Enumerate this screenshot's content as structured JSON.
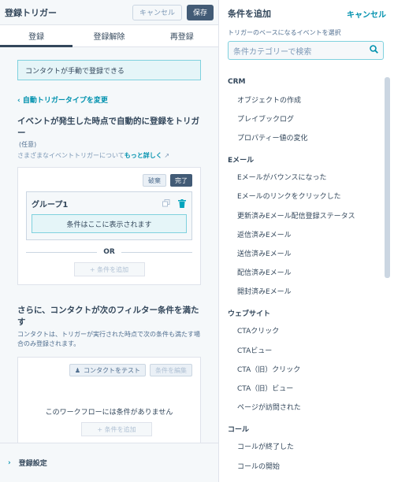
{
  "left": {
    "title": "登録トリガー",
    "cancel_label": "キャンセル",
    "save_label": "保存",
    "tabs": [
      "登録",
      "登録解除",
      "再登録"
    ],
    "banner": "コンタクトが手動で登録できる",
    "back_link": "自動トリガータイプを変更",
    "event_heading": "イベントが発生した時点で自動的に登録をトリガー",
    "optional": "(任意)",
    "help_text": "さまざまなイベントトリガーについて",
    "help_link": "もっと詳しく",
    "discard_label": "破棄",
    "done_label": "完了",
    "group_title": "グループ1",
    "condition_placeholder": "条件はここに表示されます",
    "or_label": "OR",
    "add_condition": "+ 条件を追加",
    "filter_heading": "さらに、コンタクトが次のフィルター条件を満たす",
    "filter_desc": "コンタクトは、トリガーが実行された時点で次の条件も満たす場合のみ登録されます。",
    "test_contact": "コンタクトをテスト",
    "edit_conditions": "条件を編集",
    "no_conditions": "このワークフローには条件がありません",
    "footer_label": "登録設定"
  },
  "right": {
    "title": "条件を追加",
    "cancel_label": "キャンセル",
    "subtitle": "トリガーのベースになるイベントを選択",
    "search_placeholder": "条件カテゴリーで検索",
    "categories": [
      {
        "name": "CRM",
        "items": [
          "オブジェクトの作成",
          "プレイブックログ",
          "プロパティー値の変化"
        ]
      },
      {
        "name": "Eメール",
        "items": [
          "Eメールがバウンスになった",
          "Eメールのリンクをクリックした",
          "更新済みEメール配信登録ステータス",
          "返信済みEメール",
          "送信済みEメール",
          "配信済みEメール",
          "開封済みEメール"
        ]
      },
      {
        "name": "ウェブサイト",
        "items": [
          "CTAクリック",
          "CTAビュー",
          "CTA（旧）クリック",
          "CTA（旧）ビュー",
          "ページが訪問された"
        ]
      },
      {
        "name": "コール",
        "items": [
          "コールが終了した",
          "コールの開始"
        ]
      }
    ]
  },
  "colors": {
    "accent": "#0091ae",
    "dark_button": "#425b76",
    "delete_icon": "#00a4bd"
  },
  "icons": [
    "external-link-icon",
    "clone-icon",
    "trash-icon",
    "person-icon",
    "search-icon",
    "chevron-right-icon",
    "chevron-left-icon"
  ]
}
